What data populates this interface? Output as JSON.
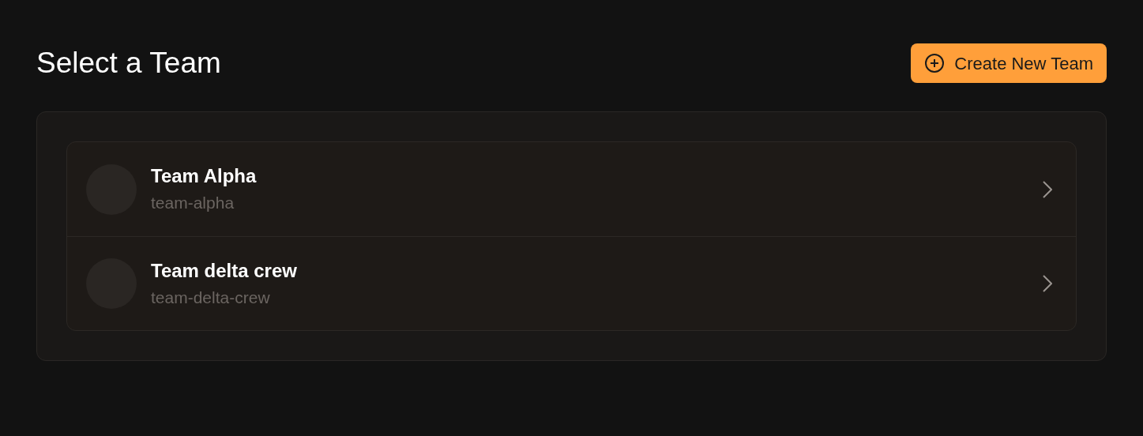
{
  "title": "Select a Team",
  "create_button": {
    "label": "Create New Team"
  },
  "teams": [
    {
      "name": "Team Alpha",
      "slug": "team-alpha"
    },
    {
      "name": "Team delta crew",
      "slug": "team-delta-crew"
    }
  ]
}
